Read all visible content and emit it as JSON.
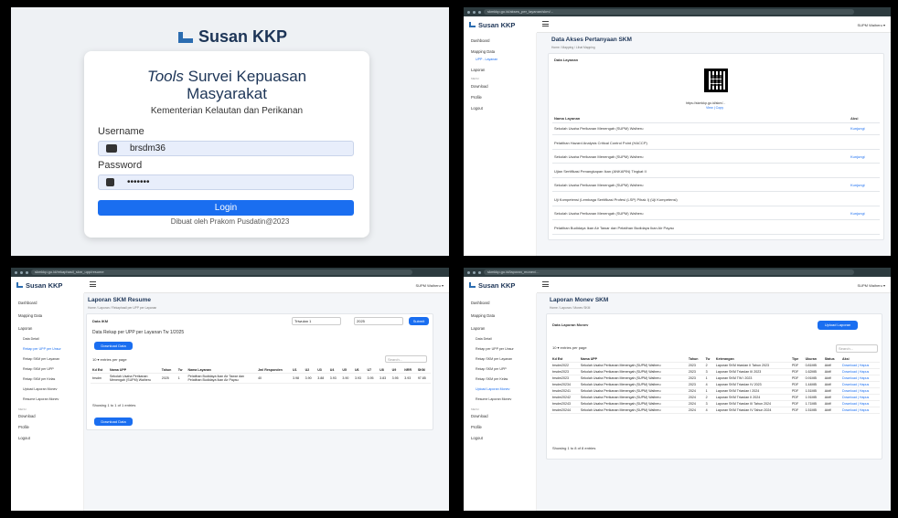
{
  "login": {
    "brand": "Susan KKP",
    "title_italic": "Tools",
    "title_rest": " Survei Kepuasan",
    "title_line2": "Masyarakat",
    "subtitle": "Kementerian Kelautan dan Perikanan",
    "username_label": "Username",
    "username_value": "brsdm36",
    "password_label": "Password",
    "password_value": "•••••••",
    "login_button": "Login",
    "footer": "Dibuat oleh Prakom Pusdatin@2023"
  },
  "app": {
    "brand": "Susan KKP",
    "user": "SUPM Waiheru ▾"
  },
  "p2": {
    "url": "skmkkp.go.id/akses_per_layanan/skm/...",
    "title": "Data Akses Pertanyaan SKM",
    "breadcrumb": "Home / Mapping / Lihat Mapping",
    "box_title": "Data Layanan",
    "qr_url": "https://skmkkp.go.id/skm/...",
    "qr_links": "View | Copy",
    "th_name": "Nama Layanan",
    "th_action": "Aksi",
    "rows": [
      {
        "a": "Sekolah Usaha Perikanan Menengah (SUPM) Waiheru",
        "b": "Kunjungi"
      },
      {
        "a": "Pelatihan Hazard Analysis Critical Control Point (HACCP)",
        "b": ""
      },
      {
        "a": "Sekolah Usaha Perikanan Menengah (SUPM) Waiheru",
        "b": "Kunjungi"
      },
      {
        "a": "Ujian Sertifikasi Penangkapan Ikan (ANKAPIN) Tingkat II",
        "b": ""
      },
      {
        "a": "Sekolah Usaha Perikanan Menengah (SUPM) Waiheru",
        "b": "Kunjungi"
      },
      {
        "a": "Uji Kompetensi (Lembaga Sertifikasi Profesi (LSP) Pihak I) (Uji Kompetensi)",
        "b": ""
      },
      {
        "a": "Sekolah Usaha Perikanan Menengah (SUPM) Waiheru",
        "b": "Kunjungi"
      },
      {
        "a": "Pelatihan Budidaya Ikan Air Tawar dan Pelatihan Budidaya Ikan Air Payau",
        "b": ""
      }
    ]
  },
  "side2": {
    "dashboard": "Dashboard",
    "mapping": "Mapping Data",
    "mapping_sub": "UPP - Layanan",
    "laporan": "Laporan",
    "menu": "MENU",
    "download": "Download",
    "profile": "Profile",
    "logout": "Logout"
  },
  "side3": {
    "dashboard": "Dashboard",
    "mapping": "Mapping Data",
    "laporan": "Laporan",
    "s1": "Data Detail",
    "s2": "Rekap per UPP per Unsur",
    "s3": "Rekap SKM per Layanan",
    "s4": "Rekap SKM per UPP",
    "s5": "Rekap SKM per Kelas",
    "s6": "Upload Laporan Monev",
    "s7": "Resume Laporan Monev",
    "menu": "MENU",
    "download": "Download",
    "profile": "Profile",
    "logout": "Logout"
  },
  "p3": {
    "url": "skmkkp.go.id/rekaphasil_skm_upp/resume",
    "title": "Laporan SKM Resume",
    "breadcrumb": "Home / Laporan / Rekaphasil per UPP per Layanan",
    "box_title": "Data IKM",
    "sel1": "Triwulan 1",
    "sel2": "2025",
    "submit": "Submit",
    "heading": "Data Rekap per UPP per Layanan Tw 1/2025",
    "download": "Download Data",
    "entries": "10 ▾ entries per page",
    "search": "Search...",
    "cols": [
      "Kd Est",
      "Nama UPP",
      "Tahun",
      "Tw",
      "Nama Layanan",
      "Jml Responden",
      "U1",
      "U2",
      "U3",
      "U4",
      "U5",
      "U6",
      "U7",
      "U8",
      "U9",
      "NRR",
      "SKM"
    ],
    "row": [
      "brsdm",
      "Sekolah Usaha Perikanan Menengah (SUPM) Waiheru",
      "2025",
      "1",
      "Pelatihan Budidaya Ikan Air Tawar dan Pelatihan Budidaya Ikan Air Payau",
      "40",
      "3.98",
      "3.90",
      "3.88",
      "3.93",
      "3.90",
      "3.93",
      "3.95",
      "3.83",
      "3.95",
      "3.93",
      "97.85"
    ],
    "showing": "Showing 1 to 1 of 1 entries",
    "download2": "Download Data"
  },
  "p4": {
    "url": "skmkkp.go.id/laporan_monev/...",
    "title": "Laporan Monev SKM",
    "breadcrumb": "Home / Laporan / Monev SKM",
    "box_title": "Data Laporan Monev",
    "upload": "Upload Laporan",
    "entries": "10 ▾ entries per page",
    "search": "Search...",
    "cols": [
      "Kd Est",
      "Nama UPP",
      "Tahun",
      "Tw",
      "Keterangan",
      "Tipe",
      "Ukuran",
      "Status",
      "Aksi"
    ],
    "rows": [
      [
        "brsdm2022",
        "Sekolah Usaha Perikanan Menengah (SUPM) Waiheru",
        "2023",
        "2",
        "Laporan SKM triwulan II Tahun 2023",
        "PDF",
        "0.81MB",
        "Aktif",
        "Download | Hapus"
      ],
      [
        "brsdm2023",
        "Sekolah Usaha Perikanan Menengah (SUPM) Waiheru",
        "2023",
        "3",
        "Laporan SKM Triwulan III 2023",
        "PDF",
        "1.62MB",
        "Aktif",
        "Download | Hapus"
      ],
      [
        "brsdm2023",
        "Sekolah Usaha Perikanan Menengah (SUPM) Waiheru",
        "2023",
        "1",
        "Laporan SKM TW I 2023",
        "PDF",
        "0.91MB",
        "Aktif",
        "Download | Hapus"
      ],
      [
        "brsdm20234",
        "Sekolah Usaha Perikanan Menengah (SUPM) Waiheru",
        "2023",
        "4",
        "Laporan SKM Triwulan IV 2023",
        "PDF",
        "1.44MB",
        "Aktif",
        "Download | Hapus"
      ],
      [
        "brsdm20241",
        "Sekolah Usaha Perikanan Menengah (SUPM) Waiheru",
        "2024",
        "1",
        "Laporan SKM Triwulan I 2024",
        "PDF",
        "1.51MB",
        "Aktif",
        "Download | Hapus"
      ],
      [
        "brsdm20242",
        "Sekolah Usaha Perikanan Menengah (SUPM) Waiheru",
        "2024",
        "2",
        "Laporan SKM Triwulan II 2024",
        "PDF",
        "1.91MB",
        "Aktif",
        "Download | Hapus"
      ],
      [
        "brsdm20243",
        "Sekolah Usaha Perikanan Menengah (SUPM) Waiheru",
        "2024",
        "3",
        "Laporan SKM Triwulan III Tahun 2024",
        "PDF",
        "1.71MB",
        "Aktif",
        "Download | Hapus"
      ],
      [
        "brsdm20244",
        "Sekolah Usaha Perikanan Menengah (SUPM) Waiheru",
        "2024",
        "4",
        "Laporan SKM Triwulan IV Tahun 2024",
        "PDF",
        "1.51MB",
        "Aktif",
        "Download | Hapus"
      ]
    ],
    "showing": "Showing 1 to 8 of 8 entries"
  }
}
